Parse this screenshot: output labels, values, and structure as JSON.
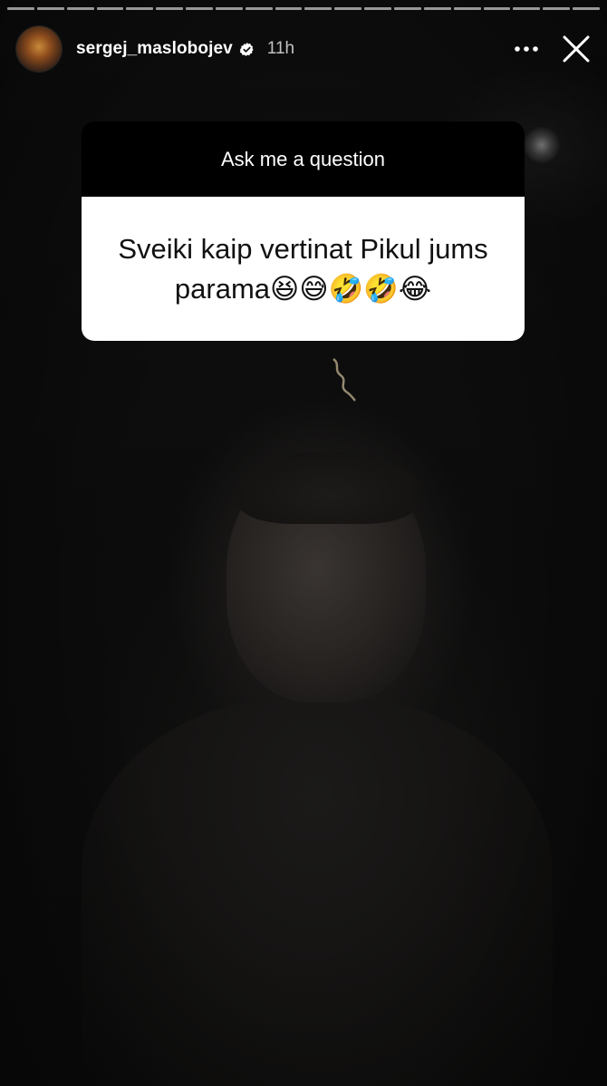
{
  "story": {
    "progress_segments": 20,
    "username": "sergej_maslobojev",
    "verified": true,
    "time_ago": "11h"
  },
  "sticker": {
    "title": "Ask me a question",
    "question": "Sveiki kaip vertinat Pikul jums parama😆😅🤣🤣😂"
  },
  "icons": {
    "more": "more-horizontal-icon",
    "close": "close-icon",
    "verified": "verified-badge-icon"
  },
  "colors": {
    "verified_badge": "#ffffff",
    "sticker_header_bg": "#000000",
    "sticker_body_bg": "#ffffff"
  }
}
